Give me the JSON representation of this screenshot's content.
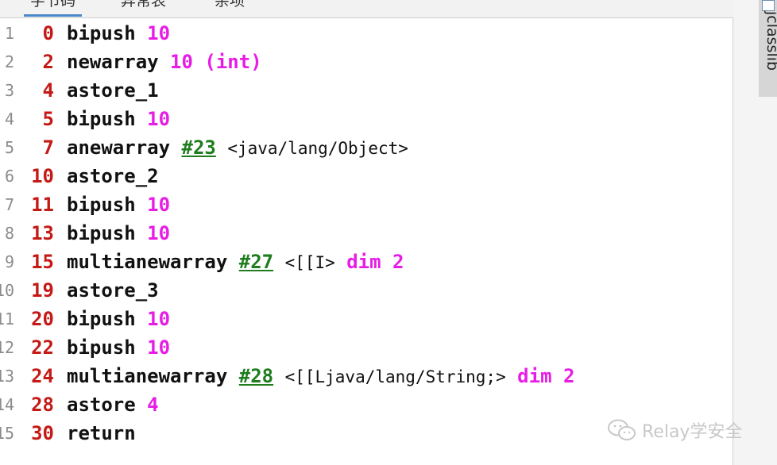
{
  "tabs": [
    {
      "label": "字节码",
      "active": true
    },
    {
      "label": "异常表",
      "active": false
    },
    {
      "label": "杂项",
      "active": false
    }
  ],
  "side_panel": {
    "label": "jclasslib"
  },
  "lines": [
    {
      "num": "1",
      "offset": "0",
      "opcode": "bipush",
      "args": [
        {
          "t": "10",
          "k": "num"
        }
      ]
    },
    {
      "num": "2",
      "offset": "2",
      "opcode": "newarray",
      "args": [
        {
          "t": "10 (int)",
          "k": "num"
        }
      ]
    },
    {
      "num": "3",
      "offset": "4",
      "opcode": "astore_1",
      "args": []
    },
    {
      "num": "4",
      "offset": "5",
      "opcode": "bipush",
      "args": [
        {
          "t": "10",
          "k": "num"
        }
      ]
    },
    {
      "num": "5",
      "offset": "7",
      "opcode": "anewarray",
      "args": [
        {
          "t": "#23",
          "k": "ref"
        },
        {
          "t": "<java/lang/Object>",
          "k": "cmt"
        }
      ]
    },
    {
      "num": "6",
      "offset": "10",
      "opcode": "astore_2",
      "args": []
    },
    {
      "num": "7",
      "offset": "11",
      "opcode": "bipush",
      "args": [
        {
          "t": "10",
          "k": "num"
        }
      ]
    },
    {
      "num": "8",
      "offset": "13",
      "opcode": "bipush",
      "args": [
        {
          "t": "10",
          "k": "num"
        }
      ]
    },
    {
      "num": "9",
      "offset": "15",
      "opcode": "multianewarray",
      "args": [
        {
          "t": "#27",
          "k": "ref"
        },
        {
          "t": "<[[I>",
          "k": "cmt"
        },
        {
          "t": "dim 2",
          "k": "num"
        }
      ]
    },
    {
      "num": "10",
      "offset": "19",
      "opcode": "astore_3",
      "args": []
    },
    {
      "num": "11",
      "offset": "20",
      "opcode": "bipush",
      "args": [
        {
          "t": "10",
          "k": "num"
        }
      ]
    },
    {
      "num": "12",
      "offset": "22",
      "opcode": "bipush",
      "args": [
        {
          "t": "10",
          "k": "num"
        }
      ]
    },
    {
      "num": "13",
      "offset": "24",
      "opcode": "multianewarray",
      "args": [
        {
          "t": "#28",
          "k": "ref"
        },
        {
          "t": "<[[Ljava/lang/String;>",
          "k": "cmt"
        },
        {
          "t": "dim 2",
          "k": "num"
        }
      ]
    },
    {
      "num": "14",
      "offset": "28",
      "opcode": "astore",
      "args": [
        {
          "t": "4",
          "k": "num"
        }
      ]
    },
    {
      "num": "15",
      "offset": "30",
      "opcode": "return",
      "args": []
    }
  ],
  "watermark": {
    "icon": "wechat-icon",
    "text": "Relay学安全"
  }
}
